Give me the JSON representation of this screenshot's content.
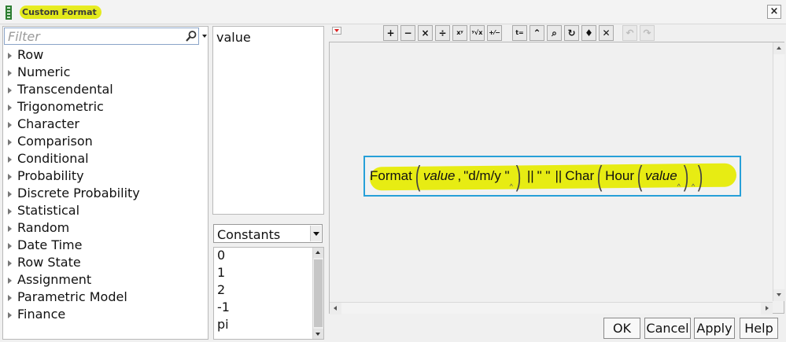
{
  "window": {
    "title": "Custom Format",
    "close_label": "×",
    "highlight_color": "#e6eb00"
  },
  "left_panel": {
    "filter_placeholder": "Filter",
    "categories": [
      "Row",
      "Numeric",
      "Transcendental",
      "Trigonometric",
      "Character",
      "Comparison",
      "Conditional",
      "Probability",
      "Discrete Probability",
      "Statistical",
      "Random",
      "Date Time",
      "Row State",
      "Assignment",
      "Parametric Model",
      "Finance"
    ]
  },
  "columns_panel": {
    "items": [
      "value"
    ]
  },
  "constants_panel": {
    "selected": "Constants",
    "items": [
      "0",
      "1",
      "2",
      "-1",
      "pi"
    ]
  },
  "toolbar": {
    "buttons": [
      {
        "label": "+",
        "name": "add-button"
      },
      {
        "label": "−",
        "name": "subtract-button"
      },
      {
        "label": "×",
        "name": "multiply-button"
      },
      {
        "label": "÷",
        "name": "divide-button"
      },
      {
        "label": "xʸ",
        "name": "power-button"
      },
      {
        "label": "ʸ√x",
        "name": "root-button"
      },
      {
        "label": "+⁄−",
        "name": "negate-button"
      },
      {
        "label": "t=",
        "name": "assign-button"
      },
      {
        "label": "⌃",
        "name": "peel-expression-button"
      },
      {
        "label": "⌕",
        "name": "local-variable-button"
      },
      {
        "label": "↻",
        "name": "reorder-button"
      },
      {
        "label": "♦",
        "name": "macro-button"
      },
      {
        "label": "✕",
        "name": "delete-expression-button"
      },
      {
        "label": "↶",
        "name": "undo-button"
      },
      {
        "label": "↷",
        "name": "redo-button"
      }
    ]
  },
  "formula": {
    "func": "Format",
    "arg1": "value",
    "comma": ",",
    "format_str": "\"d/m/y \"",
    "concat1": "||",
    "space_str": "\" \"",
    "concat2": "||",
    "char_func": "Char",
    "hour_func": "Hour",
    "arg2": "value",
    "caret": "^"
  },
  "buttons": {
    "ok": "OK",
    "cancel": "Cancel",
    "apply": "Apply",
    "help": "Help"
  }
}
